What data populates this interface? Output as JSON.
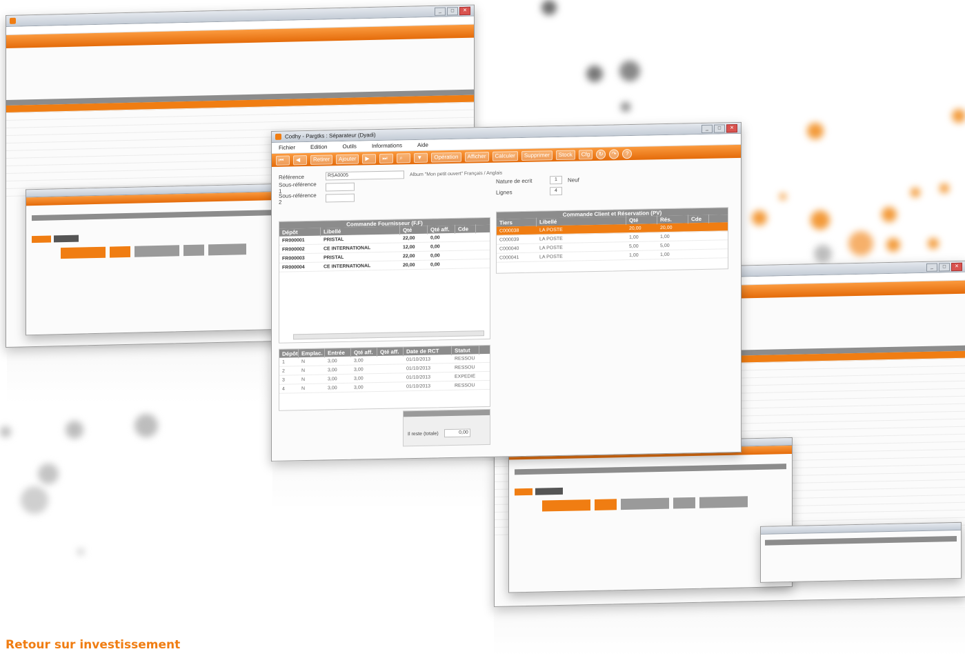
{
  "footer": {
    "title": "Retour sur investissement"
  },
  "colors": {
    "accent": "#f07d12",
    "grid_header": "#8c8c8c",
    "selection": "#f07d12"
  },
  "main_window": {
    "title": "Codhy - Pargtks : Séparateur (Dyadi)",
    "menus": [
      "Fichier",
      "Edition",
      "Outils",
      "Informations",
      "Aide"
    ],
    "toolbar": {
      "nav_first": "Retirer",
      "nav_next": "Ajouter",
      "operation": "Opération",
      "afficher": "Afficher",
      "calculer": "Calculer",
      "supprimer": "Supprimer",
      "stock": "Stock",
      "cfg": "Cfg"
    },
    "form": {
      "field1_label": "Référence",
      "field1_value": "RSA0005",
      "descr_text": "Album \"Mon petit ouvert\" Français / Anglais",
      "field2_label": "Sous-référence 1",
      "field3_label": "Sous-référence 2",
      "right1_label": "Nature de ecrit",
      "right1_value": "1",
      "right1_extra": "Neuf",
      "right2_label": "Lignes",
      "right2_value": "4"
    },
    "left_grid": {
      "title": "Commande Fournisseur (F.F)",
      "headers": [
        "Dépôt",
        "Libellé",
        "Qté",
        "Qté aff.",
        "Cde"
      ],
      "rows": [
        [
          "FR000001",
          "PRISTAL",
          "22,00",
          "0,00"
        ],
        [
          "FR000002",
          "CE INTERNATIONAL",
          "12,00",
          "0,00"
        ],
        [
          "FR000003",
          "PRISTAL",
          "22,00",
          "0,00"
        ],
        [
          "FR000004",
          "CE INTERNATIONAL",
          "20,00",
          "0,00"
        ]
      ]
    },
    "right_grid": {
      "title": "Commande Client et Réservation (PV)",
      "headers": [
        "Tiers",
        "Libellé",
        "Qté",
        "Rés.",
        "Cde"
      ],
      "rows": [
        [
          "C000038",
          "LA POSTE",
          "20,00",
          "20,00"
        ],
        [
          "C000039",
          "LA POSTE",
          "1,00",
          "1,00"
        ],
        [
          "C000040",
          "LA POSTE",
          "5,00",
          "5,00"
        ],
        [
          "C000041",
          "LA POSTE",
          "1,00",
          "1,00"
        ]
      ]
    },
    "bottom_grid": {
      "headers": [
        "Dépôt",
        "Emplac.",
        "Entrée",
        "Qté aff.",
        "Qté aff.",
        "Date de RCT",
        "Statut"
      ],
      "rows": [
        [
          "1",
          "N",
          "3,00",
          "3,00",
          "01/10/2013",
          "RESSOU"
        ],
        [
          "2",
          "N",
          "3,00",
          "3,00",
          "01/10/2013",
          "RESSOU"
        ],
        [
          "3",
          "N",
          "3,00",
          "3,00",
          "01/10/2013",
          "EXPÉDIÉ"
        ],
        [
          "4",
          "N",
          "3,00",
          "3,00",
          "01/10/2013",
          "RESSOU"
        ]
      ]
    },
    "status": {
      "label": "Il reste (totale)",
      "value": "0,00"
    }
  }
}
